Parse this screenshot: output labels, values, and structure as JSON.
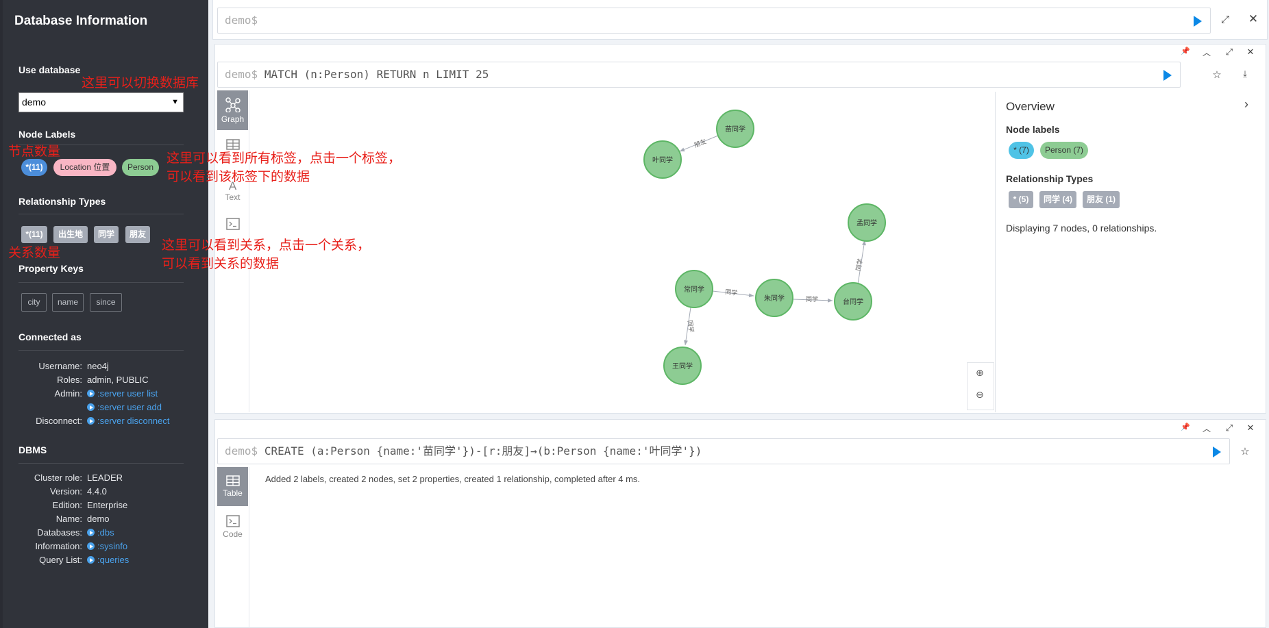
{
  "sidebar": {
    "title": "Database Information",
    "use_database": "Use database",
    "selected_db": "demo",
    "node_labels_title": "Node Labels",
    "node_labels": [
      {
        "label": "*(11)",
        "color": "#4c8eda"
      },
      {
        "label": "Location 位置",
        "color": "#f9b6c4"
      },
      {
        "label": "Person",
        "color": "#57c7a2"
      }
    ],
    "rel_types_title": "Relationship Types",
    "rel_types": [
      "*(11)",
      "出生地",
      "同学",
      "朋友"
    ],
    "prop_keys_title": "Property Keys",
    "prop_keys": [
      "city",
      "name",
      "since"
    ],
    "connected_title": "Connected as",
    "username_label": "Username:",
    "username": "neo4j",
    "roles_label": "Roles:",
    "roles": "admin, PUBLIC",
    "admin_label": "Admin:",
    "admin_link1": ":server user list",
    "admin_link2": ":server user add",
    "disconnect_label": "Disconnect:",
    "disconnect_link": ":server disconnect",
    "dbms_title": "DBMS",
    "cluster_label": "Cluster role:",
    "cluster": "LEADER",
    "version_label": "Version:",
    "version": "4.4.0",
    "edition_label": "Edition:",
    "edition": "Enterprise",
    "name_label": "Name:",
    "name": "demo",
    "databases_label": "Databases:",
    "databases_link": ":dbs",
    "information_label": "Information:",
    "information_link": ":sysinfo",
    "querylist_label": "Query List:",
    "querylist_link": ":queries"
  },
  "annotations": {
    "switch_db": "这里可以切换数据库",
    "node_count": "节点数量",
    "labels_line1": "这里可以看到所有标签，点击一个标签，",
    "labels_line2": "可以看到该标签下的数据",
    "rel_count": "关系数量",
    "rels_line1": "这里可以看到关系，点击一个关系，",
    "rels_line2": "可以看到关系的数据"
  },
  "top_editor": {
    "prompt": "demo$"
  },
  "frame1": {
    "prompt": "demo$",
    "query": "MATCH (n:Person) RETURN n LIMIT 25",
    "tabs": [
      "Graph",
      "Table",
      "Text",
      "Code"
    ],
    "graph": {
      "nodes": [
        "苗同学",
        "叶同学",
        "孟同学",
        "常同学",
        "朱同学",
        "台同学",
        "王同学"
      ],
      "edges": [
        "朋友",
        "同学",
        "同学",
        "同学",
        "同学"
      ],
      "node_color": "#8dcc93"
    },
    "overview": {
      "title": "Overview",
      "node_labels_title": "Node labels",
      "node_labels": [
        "* (7)",
        "Person (7)"
      ],
      "rel_types_title": "Relationship Types",
      "rel_types": [
        "* (5)",
        "同学 (4)",
        "朋友 (1)"
      ],
      "display_text": "Displaying 7 nodes, 0 relationships."
    }
  },
  "frame2": {
    "prompt": "demo$",
    "query": "CREATE (a:Person {name:'苗同学'})-[r:朋友]→(b:Person {name:'叶同学'})",
    "tabs": [
      "Table",
      "Code"
    ],
    "message": "Added 2 labels, created 2 nodes, set 2 properties, created 1 relationship, completed after 4 ms."
  }
}
